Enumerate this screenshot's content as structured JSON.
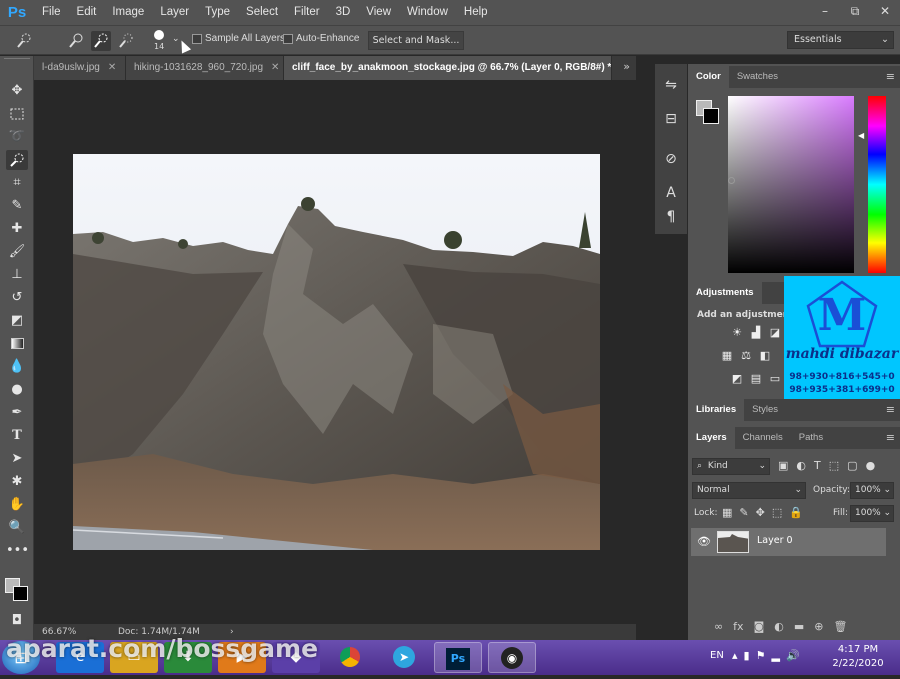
{
  "app": {
    "logo": "Ps"
  },
  "menu": [
    "File",
    "Edit",
    "Image",
    "Layer",
    "Type",
    "Select",
    "Filter",
    "3D",
    "View",
    "Window",
    "Help"
  ],
  "window_controls": [
    "–",
    "⧉",
    "✕"
  ],
  "options": {
    "brush_size": "14",
    "sample_all_layers": "Sample All Layers",
    "auto_enhance": "Auto-Enhance",
    "select_and_mask": "Select and Mask...",
    "workspace": "Essentials",
    "workspace_arrow": "⌄"
  },
  "tabs": [
    {
      "label": "l-da9uslw.jpg",
      "close": "✕"
    },
    {
      "label": "hiking-1031628_960_720.jpg",
      "close": "✕"
    },
    {
      "label": "cliff_face_by_anakmoon_stockage.jpg @ 66.7% (Layer 0, RGB/8#) *",
      "close": "✕"
    }
  ],
  "tabs_more": "»",
  "status": {
    "zoom": "66.67%",
    "doc": "Doc: 1.74M/1.74M",
    "arrow": "›"
  },
  "panels": {
    "color_tabs": [
      "Color",
      "Swatches"
    ],
    "adjustments_tab": "Adjustments",
    "adjustments_hint": "Add an adjustment",
    "libraries_tabs": [
      "Libraries",
      "Styles"
    ],
    "layers_tabs": [
      "Layers",
      "Channels",
      "Paths"
    ],
    "kind_filter": "Kind",
    "filter_icon": "⌕",
    "blend_mode": "Normal",
    "opacity_label": "Opacity:",
    "opacity_value": "100%",
    "lock_label": "Lock:",
    "fill_label": "Fill:",
    "fill_value": "100%",
    "layer_name": "Layer 0",
    "menu_icon": "≡",
    "dropdown_arrow": "⌄"
  },
  "watermark": {
    "logo": "M",
    "name": "mahdi dibazar",
    "phone1": "98+930+816+545+0",
    "phone2": "98+935+381+699+0"
  },
  "taskbar": {
    "lang": "EN",
    "time": "4:17 PM",
    "date": "2/22/2020",
    "overlay_text": "aparat.com/bossgame"
  },
  "colors": {
    "chrome": "#535353",
    "canvas": "#282828",
    "accent": "#31a8ff",
    "watermark_bg": "#00c6ff"
  }
}
